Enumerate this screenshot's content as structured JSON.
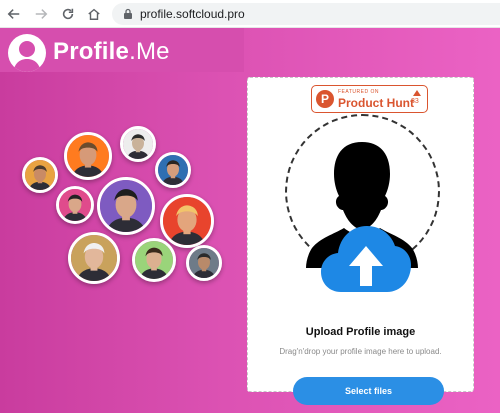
{
  "browser": {
    "url": "profile.softcloud.pro"
  },
  "header": {
    "brand_bold": "Profile",
    "brand_light": ".Me"
  },
  "product_hunt": {
    "featured_label": "FEATURED ON",
    "name": "Product Hunt",
    "votes": "33"
  },
  "upload": {
    "title": "Upload Profile image",
    "hint": "Drag'n'drop your profile image here to upload.",
    "button_label": "Select files"
  },
  "colors": {
    "page_gradient_start": "#c93c9e",
    "page_gradient_end": "#eb62c4",
    "product_hunt": "#da552f",
    "upload_blue": "#2b8fe5",
    "cloud_blue": "#1e88e5"
  },
  "avatars": [
    {
      "name": "avatar-1",
      "bg": "#e8a341",
      "skin": "#c98b65",
      "hair": "#4a3b2d"
    },
    {
      "name": "avatar-2",
      "bg": "#ff7b1f",
      "skin": "#d69a78",
      "hair": "#6a4c2e"
    },
    {
      "name": "avatar-3",
      "bg": "#ededed",
      "skin": "#c9b29a",
      "hair": "#2b2b2b"
    },
    {
      "name": "avatar-4",
      "bg": "#2f6fb2",
      "skin": "#d49d7c",
      "hair": "#2a2622"
    },
    {
      "name": "avatar-5",
      "bg": "#e04b8c",
      "skin": "#d9a789",
      "hair": "#222222"
    },
    {
      "name": "avatar-6",
      "bg": "#7e5bc1",
      "skin": "#d9a789",
      "hair": "#1e1e1e"
    },
    {
      "name": "avatar-7",
      "bg": "#e8442d",
      "skin": "#e3a57c",
      "hair": "#f2c46a"
    },
    {
      "name": "avatar-8",
      "bg": "#c9a25c",
      "skin": "#e2b79b",
      "hair": "#f0f0f0"
    },
    {
      "name": "avatar-9",
      "bg": "#9ad47a",
      "skin": "#dbb090",
      "hair": "#3a2a1c"
    },
    {
      "name": "avatar-10",
      "bg": "#6e7b88",
      "skin": "#b88a6a",
      "hair": "#2b2b2b"
    }
  ]
}
